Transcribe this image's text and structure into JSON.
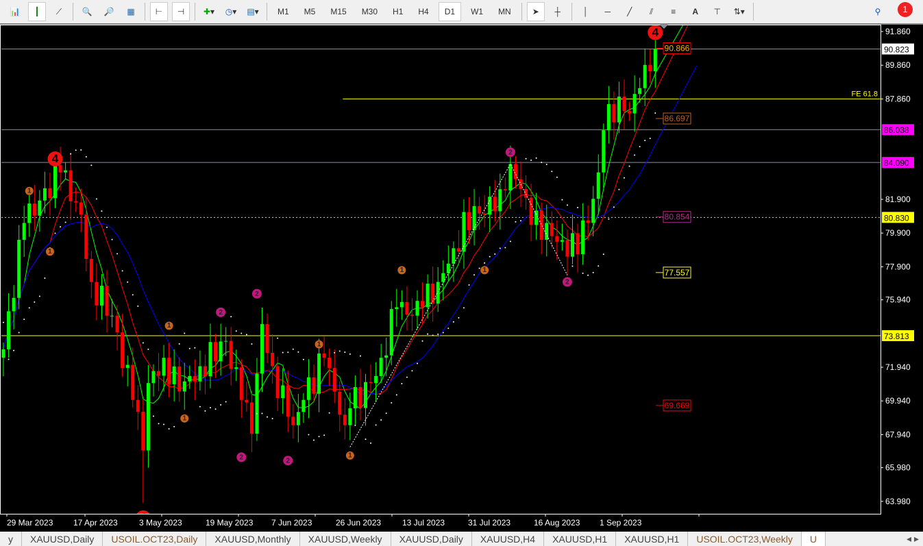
{
  "toolbar": {
    "timeframes": [
      "M1",
      "M5",
      "M15",
      "M30",
      "H1",
      "H4",
      "D1",
      "W1",
      "MN"
    ],
    "active_timeframe": "D1",
    "text_tool": "A",
    "notification_count": "1"
  },
  "tabs": [
    "y",
    "XAUUSD,Daily",
    "USOIL.OCT23,Daily",
    "XAUUSD,Monthly",
    "XAUUSD,Weekly",
    "XAUUSD,Daily",
    "XAUUSD,H4",
    "XAUUSD,H1",
    "XAUUSD,H1",
    "USOIL.OCT23,Weekly",
    "U"
  ],
  "dates": [
    "29 Mar 2023",
    "17 Apr 2023",
    "3 May 2023",
    "19 May 2023",
    "7 Jun 2023",
    "26 Jun 2023",
    "13 Jul 2023",
    "31 Jul 2023",
    "16 Aug 2023",
    "1 Sep 2023"
  ],
  "colors": {
    "bull": "#00ff00",
    "bear": "#ff0000",
    "ma_fast": "#00ff00",
    "ma_mid": "#ff0000",
    "ma_slow": "#0000ff",
    "yellow": "#ffff00",
    "magenta": "#ff00ff"
  },
  "chart_data": {
    "type": "candlestick",
    "symbol": "USOIL.OCT23,Daily",
    "ylim": [
      63.2,
      92.3
    ],
    "price_ticks": [
      "91.860",
      "89.860",
      "87.860",
      "81.900",
      "79.900",
      "77.900",
      "75.940",
      "71.940",
      "69.940",
      "67.940",
      "65.980",
      "63.980"
    ],
    "close_keypoints": [
      [
        0,
        73
      ],
      [
        4,
        80.5
      ],
      [
        11,
        83.5
      ],
      [
        15,
        81
      ],
      [
        17,
        77
      ],
      [
        21,
        75
      ],
      [
        25,
        70
      ],
      [
        27,
        67
      ],
      [
        28,
        71
      ],
      [
        31,
        72.5
      ],
      [
        34,
        70.5
      ],
      [
        38,
        72
      ],
      [
        43,
        73.5
      ],
      [
        46,
        70
      ],
      [
        48,
        68
      ],
      [
        50,
        74.5
      ],
      [
        52,
        72
      ],
      [
        55,
        69
      ],
      [
        56,
        68.5
      ],
      [
        58,
        70
      ],
      [
        62,
        72.5
      ],
      [
        66,
        68.5
      ],
      [
        67,
        69.5
      ],
      [
        71,
        71
      ],
      [
        73,
        72.5
      ],
      [
        76,
        75.5
      ],
      [
        79,
        75
      ],
      [
        81,
        75.5
      ],
      [
        84,
        77
      ],
      [
        87,
        79
      ],
      [
        91,
        81.5
      ],
      [
        93,
        81
      ],
      [
        96,
        82.5
      ],
      [
        98,
        84
      ],
      [
        101,
        82
      ],
      [
        104,
        79.5
      ],
      [
        105,
        80.5
      ],
      [
        109,
        78.5
      ],
      [
        113,
        80.5
      ],
      [
        115,
        83.5
      ],
      [
        116,
        86
      ],
      [
        119,
        88
      ],
      [
        121,
        87
      ],
      [
        123,
        88.5
      ],
      [
        125,
        89.5
      ],
      [
        126,
        90.82
      ]
    ],
    "axis_labels": [
      {
        "price": 90.823,
        "text": "90.823",
        "bg": "#ffffff",
        "fg": "#000"
      },
      {
        "price": 86.038,
        "text": "86.038",
        "bg": "#ff00ff",
        "fg": "#000"
      },
      {
        "price": 84.09,
        "text": "84.090",
        "bg": "#ff00ff",
        "fg": "#000"
      },
      {
        "price": 80.83,
        "text": "80.830",
        "bg": "#ffff00",
        "fg": "#000"
      },
      {
        "price": 73.813,
        "text": "73.813",
        "bg": "#ffff00",
        "fg": "#000"
      }
    ],
    "hlines": [
      {
        "price": 90.823,
        "color": "#8a8f99",
        "from": 0,
        "dash": ""
      },
      {
        "price": 87.86,
        "color": "#ffff00",
        "from": 66,
        "dash": "",
        "label": "FE 61.8"
      },
      {
        "price": 86.038,
        "color": "#8a8f99",
        "from": 0,
        "dash": ""
      },
      {
        "price": 84.09,
        "color": "#8a8f99",
        "from": 0,
        "dash": ""
      },
      {
        "price": 80.83,
        "color": "#cccccc",
        "from": 0,
        "dash": "2,3"
      },
      {
        "price": 73.813,
        "color": "#ffff00",
        "from": 0,
        "dash": ""
      }
    ],
    "price_boxes": [
      {
        "price": 90.866,
        "text": "90.866",
        "color": "#ff0000",
        "fg": "#ffaa00"
      },
      {
        "price": 86.697,
        "text": "86.697",
        "color": "#c06020",
        "fg": "#c06020"
      },
      {
        "price": 80.854,
        "text": "80.854",
        "color": "#b0308a",
        "fg": "#b0308a"
      },
      {
        "price": 77.557,
        "text": "77.557",
        "color": "#ffff00",
        "fg": "#ffff00"
      },
      {
        "price": 69.669,
        "text": "69.669",
        "color": "#ff0000",
        "fg": "#ff0000"
      }
    ],
    "wave_labels": [
      {
        "i": 5,
        "p": 82.4,
        "t": "1",
        "c": "#c8641e",
        "r": 6
      },
      {
        "i": 9,
        "p": 78.8,
        "t": "1",
        "c": "#c8641e",
        "r": 6
      },
      {
        "i": 32,
        "p": 74.4,
        "t": "1",
        "c": "#c8641e",
        "r": 6
      },
      {
        "i": 35,
        "p": 68.9,
        "t": "1",
        "c": "#c8641e",
        "r": 6
      },
      {
        "i": 61,
        "p": 73.3,
        "t": "1",
        "c": "#c8641e",
        "r": 6
      },
      {
        "i": 67,
        "p": 66.7,
        "t": "1",
        "c": "#c8641e",
        "r": 6
      },
      {
        "i": 77,
        "p": 77.7,
        "t": "1",
        "c": "#c8641e",
        "r": 6
      },
      {
        "i": 93,
        "p": 77.7,
        "t": "1",
        "c": "#c8641e",
        "r": 6
      },
      {
        "i": 42,
        "p": 75.2,
        "t": "2",
        "c": "#c0187c",
        "r": 7
      },
      {
        "i": 49,
        "p": 76.3,
        "t": "2",
        "c": "#c0187c",
        "r": 7
      },
      {
        "i": 46,
        "p": 66.6,
        "t": "2",
        "c": "#c0187c",
        "r": 7
      },
      {
        "i": 55,
        "p": 66.4,
        "t": "2",
        "c": "#c0187c",
        "r": 7
      },
      {
        "i": 98,
        "p": 84.7,
        "t": "2",
        "c": "#c0187c",
        "r": 7
      },
      {
        "i": 109,
        "p": 77.0,
        "t": "2",
        "c": "#c0187c",
        "r": 7
      },
      {
        "i": 10,
        "p": 84.3,
        "t": "4",
        "c": "#ee1111",
        "r": 11
      },
      {
        "i": 126,
        "p": 91.8,
        "t": "4",
        "c": "#ee1111",
        "r": 11
      },
      {
        "i": 27,
        "p": 63.0,
        "t": "4",
        "c": "#ee1111",
        "r": 11
      }
    ],
    "zigzag": [
      [
        67,
        67.2
      ],
      [
        98,
        84.0
      ],
      [
        109,
        77.4
      ]
    ]
  }
}
